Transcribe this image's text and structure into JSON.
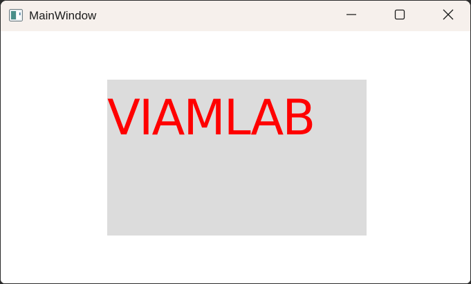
{
  "window": {
    "title": "MainWindow"
  },
  "titlebar": {
    "minimize_icon": "minimize-icon",
    "maximize_icon": "maximize-icon",
    "close_icon": "close-icon",
    "app_icon": "app-window-icon"
  },
  "label": {
    "text": "VIAMLAB",
    "text_color": "#ff0000",
    "background_color": "#dcdcdc"
  }
}
